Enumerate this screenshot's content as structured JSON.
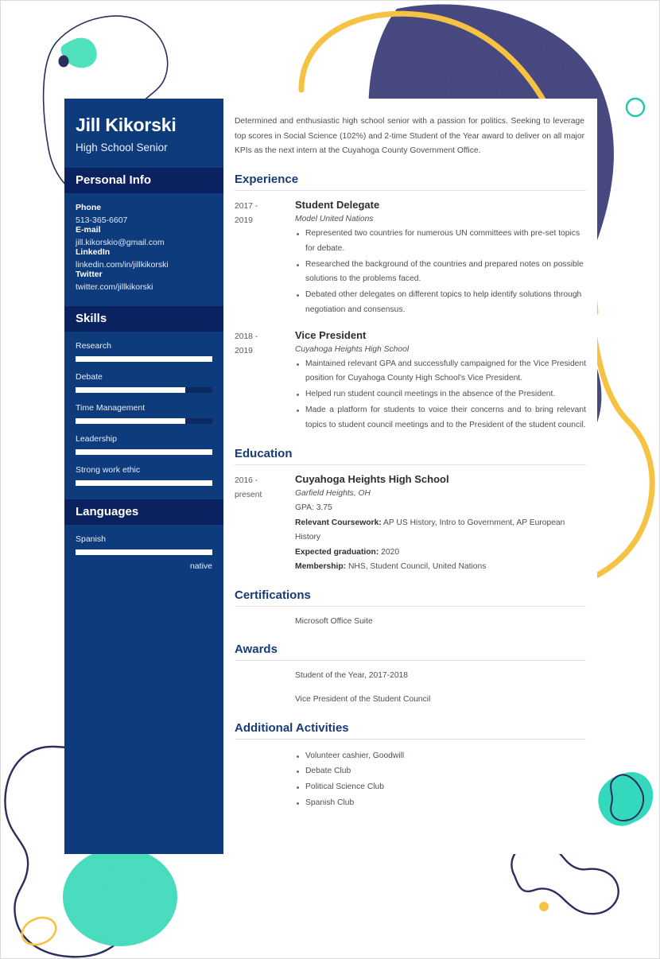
{
  "colors": {
    "sidebar_bg": "#0e3b7c",
    "sidebar_header_bg": "#0a2260",
    "accent_navy": "#173b78",
    "teal": "#34d8bd",
    "yellow": "#f5c243",
    "dark_navy_outline": "#2b2d5c",
    "body_text": "#4b5057"
  },
  "sidebar": {
    "name": "Jill Kikorski",
    "role": "High School Senior",
    "personal_info": {
      "heading": "Personal Info",
      "fields": [
        {
          "label": "Phone",
          "value": "513-365-6607"
        },
        {
          "label": "E-mail",
          "value": "jill.kikorskio@gmail.com"
        },
        {
          "label": "LinkedIn",
          "value": "linkedin.com/in/jillkikorski"
        },
        {
          "label": "Twitter",
          "value": "twitter.com/jillkikorski"
        }
      ]
    },
    "skills": {
      "heading": "Skills",
      "items": [
        {
          "name": "Research",
          "level": 100
        },
        {
          "name": "Debate",
          "level": 80
        },
        {
          "name": "Time Management",
          "level": 80
        },
        {
          "name": "Leadership",
          "level": 100
        },
        {
          "name": "Strong work ethic",
          "level": 100
        }
      ]
    },
    "languages": {
      "heading": "Languages",
      "items": [
        {
          "name": "Spanish",
          "level": 100,
          "proficiency": "native"
        }
      ]
    }
  },
  "main": {
    "summary": "Determined and enthusiastic high school senior with a passion for politics. Seeking to leverage top scores in Social Science (102%) and 2-time Student of the Year award to deliver on all major KPIs as the next intern at the Cuyahoga County Government Office.",
    "experience": {
      "heading": "Experience",
      "entries": [
        {
          "date_from": "2017 -",
          "date_to": "2019",
          "title": "Student Delegate",
          "subtitle": "Model United Nations",
          "bullets": [
            "Represented two countries for numerous UN committees with pre-set topics for debate.",
            "Researched the background of the countries and prepared notes on possible solutions to the problems faced.",
            "Debated other delegates on different topics to help identify solutions through negotiation and consensus."
          ]
        },
        {
          "date_from": "2018 -",
          "date_to": "2019",
          "title": "Vice President",
          "subtitle": "Cuyahoga Heights High School",
          "bullets": [
            "Maintained relevant GPA and successfully campaigned for the Vice President position for Cuyahoga County High School's Vice President.",
            "Helped run student council meetings in the absence of the President.",
            "Made a platform for students to voice their concerns and to bring relevant topics to student council meetings and to the President of the student council."
          ]
        }
      ]
    },
    "education": {
      "heading": "Education",
      "date_from": "2016 -",
      "date_to": "present",
      "school": "Cuyahoga Heights High School",
      "location": "Garfield Heights, OH",
      "gpa": "GPA: 3.75",
      "coursework_label": "Relevant Coursework:",
      "coursework_value": " AP US History, Intro to Government, AP European History",
      "graduation_label": "Expected graduation:",
      "graduation_value": " 2020",
      "membership_label": "Membership:",
      "membership_value": " NHS, Student Council, United Nations"
    },
    "certifications": {
      "heading": "Certifications",
      "items": [
        "Microsoft Office Suite"
      ]
    },
    "awards": {
      "heading": "Awards",
      "items": [
        "Student of the Year, 2017-2018",
        "Vice President of the Student Council"
      ]
    },
    "additional_activities": {
      "heading": "Additional Activities",
      "items": [
        "Volunteer cashier, Goodwill",
        "Debate Club",
        "Political Science Club",
        "Spanish Club"
      ]
    }
  }
}
